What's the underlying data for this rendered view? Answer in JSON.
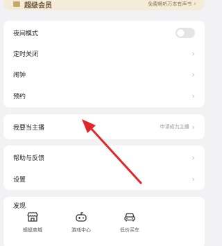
{
  "vip_banner": {
    "title": "超级会员",
    "subtitle": "免费畅听万本有声书",
    "chevron": "›"
  },
  "settings_group_1": [
    {
      "label": "夜间模式",
      "control": "toggle",
      "enabled": false
    },
    {
      "label": "定时关闭",
      "control": "chevron",
      "chevron": "›"
    },
    {
      "label": "闹钟",
      "control": "chevron",
      "chevron": "›"
    },
    {
      "label": "预约",
      "control": "chevron",
      "chevron": "›"
    }
  ],
  "anchor_row": {
    "label": "我要当主播",
    "hint": "申请成为主播",
    "chevron": "›"
  },
  "settings_group_2": [
    {
      "label": "帮助与反馈",
      "chevron": "›"
    },
    {
      "label": "设置",
      "chevron": "›"
    }
  ],
  "discover": {
    "title": "发现",
    "items": [
      {
        "label": "蜻蜓商城",
        "icon": "shop-icon"
      },
      {
        "label": "游戏中心",
        "icon": "gamepad-icon"
      },
      {
        "label": "低价买车",
        "icon": "car-icon"
      }
    ]
  },
  "colors": {
    "accent_arrow": "#e0262b",
    "vip_bg": "#f4ecd9",
    "page_bg": "#f2f2f4"
  }
}
